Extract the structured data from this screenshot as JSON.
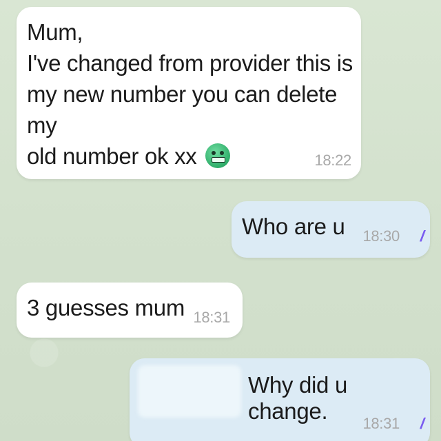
{
  "messages": [
    {
      "direction": "incoming",
      "text": "Mum,\nI've changed from provider this is\nmy new number you can delete my\nold number ok xx",
      "emoji": "grimacing-face-icon",
      "time": "18:22"
    },
    {
      "direction": "outgoing",
      "text": "Who are u",
      "time": "18:30",
      "status": "read"
    },
    {
      "direction": "incoming",
      "text": "3 guesses mum",
      "time": "18:31"
    },
    {
      "direction": "outgoing",
      "text": "Why did u change.",
      "time": "18:31",
      "status": "read"
    }
  ],
  "colors": {
    "incoming_bubble": "#ffffff",
    "outgoing_bubble": "#dcebf5",
    "read_ticks": "#7a5cf0",
    "wallpaper": "#d6e3d0"
  }
}
